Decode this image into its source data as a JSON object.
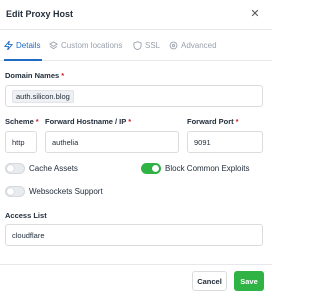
{
  "dialog": {
    "title": "Edit Proxy Host",
    "close_icon": "close-icon"
  },
  "tabs": [
    {
      "label": "Details",
      "icon": "lightning-icon",
      "active": true
    },
    {
      "label": "Custom locations",
      "icon": "layers-icon",
      "active": false
    },
    {
      "label": "SSL",
      "icon": "shield-icon",
      "active": false
    },
    {
      "label": "Advanced",
      "icon": "settings-icon",
      "active": false
    }
  ],
  "form": {
    "domain_names": {
      "label": "Domain Names",
      "required": "*",
      "value": "auth.silicon.blog"
    },
    "scheme": {
      "label": "Scheme",
      "required": "*",
      "value": "http"
    },
    "forward_host": {
      "label": "Forward Hostname / IP",
      "required": "*",
      "value": "authelia"
    },
    "forward_port": {
      "label": "Forward Port",
      "required": "*",
      "value": "9091"
    },
    "cache_assets": {
      "label": "Cache Assets",
      "enabled": false
    },
    "block_exploits": {
      "label": "Block Common Exploits",
      "enabled": true
    },
    "websockets": {
      "label": "Websockets Support",
      "enabled": false
    },
    "access_list": {
      "label": "Access List",
      "value": "cloudflare"
    }
  },
  "footer": {
    "cancel_label": "Cancel",
    "save_label": "Save"
  },
  "colors": {
    "accent": "#206bc4",
    "success": "#2fb344",
    "required": "#cd201f"
  }
}
